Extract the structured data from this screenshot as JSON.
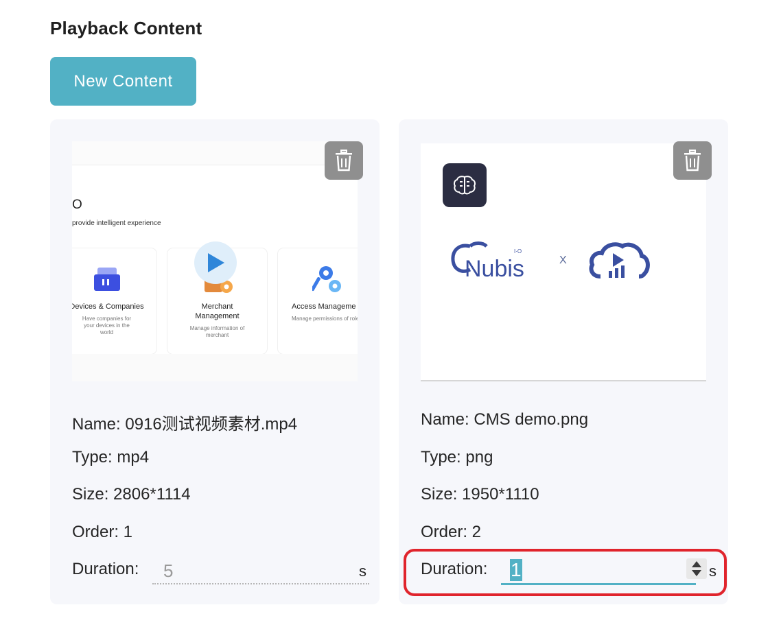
{
  "page": {
    "title": "Playback Content"
  },
  "toolbar": {
    "new_content_label": "New Content"
  },
  "colors": {
    "accent": "#52b1c5",
    "card_bg": "#f6f7fb",
    "delete_bg": "#8f8f8f",
    "highlight": "#e0242c"
  },
  "contents": [
    {
      "name": "Name: 0916测试视频素材.mp4",
      "type": "Type: mp4",
      "size": "Size: 2806*1114",
      "order": "Order: 1",
      "duration_label": "Duration:",
      "duration_value": "5",
      "duration_unit": "s",
      "thumbnail": {
        "kind": "video",
        "partial_heading": "O",
        "tagline": "provide intelligent experience",
        "tiles": [
          {
            "title": "Devices & Companies",
            "desc": "Have companies for your devices in the world"
          },
          {
            "title": "Merchant Management",
            "desc": "Manage information of merchant"
          },
          {
            "title": "Access Manageme",
            "desc": "Manage permissions of role"
          }
        ]
      }
    },
    {
      "name": "Name: CMS demo.png",
      "type": "Type: png",
      "size": "Size: 1950*1110",
      "order": "Order: 2",
      "duration_label": "Duration:",
      "duration_value": "1",
      "duration_unit": "s",
      "thumbnail": {
        "kind": "image",
        "logo_text": "Nubis",
        "logo_superscript": "I·O",
        "separator": "X"
      }
    }
  ]
}
